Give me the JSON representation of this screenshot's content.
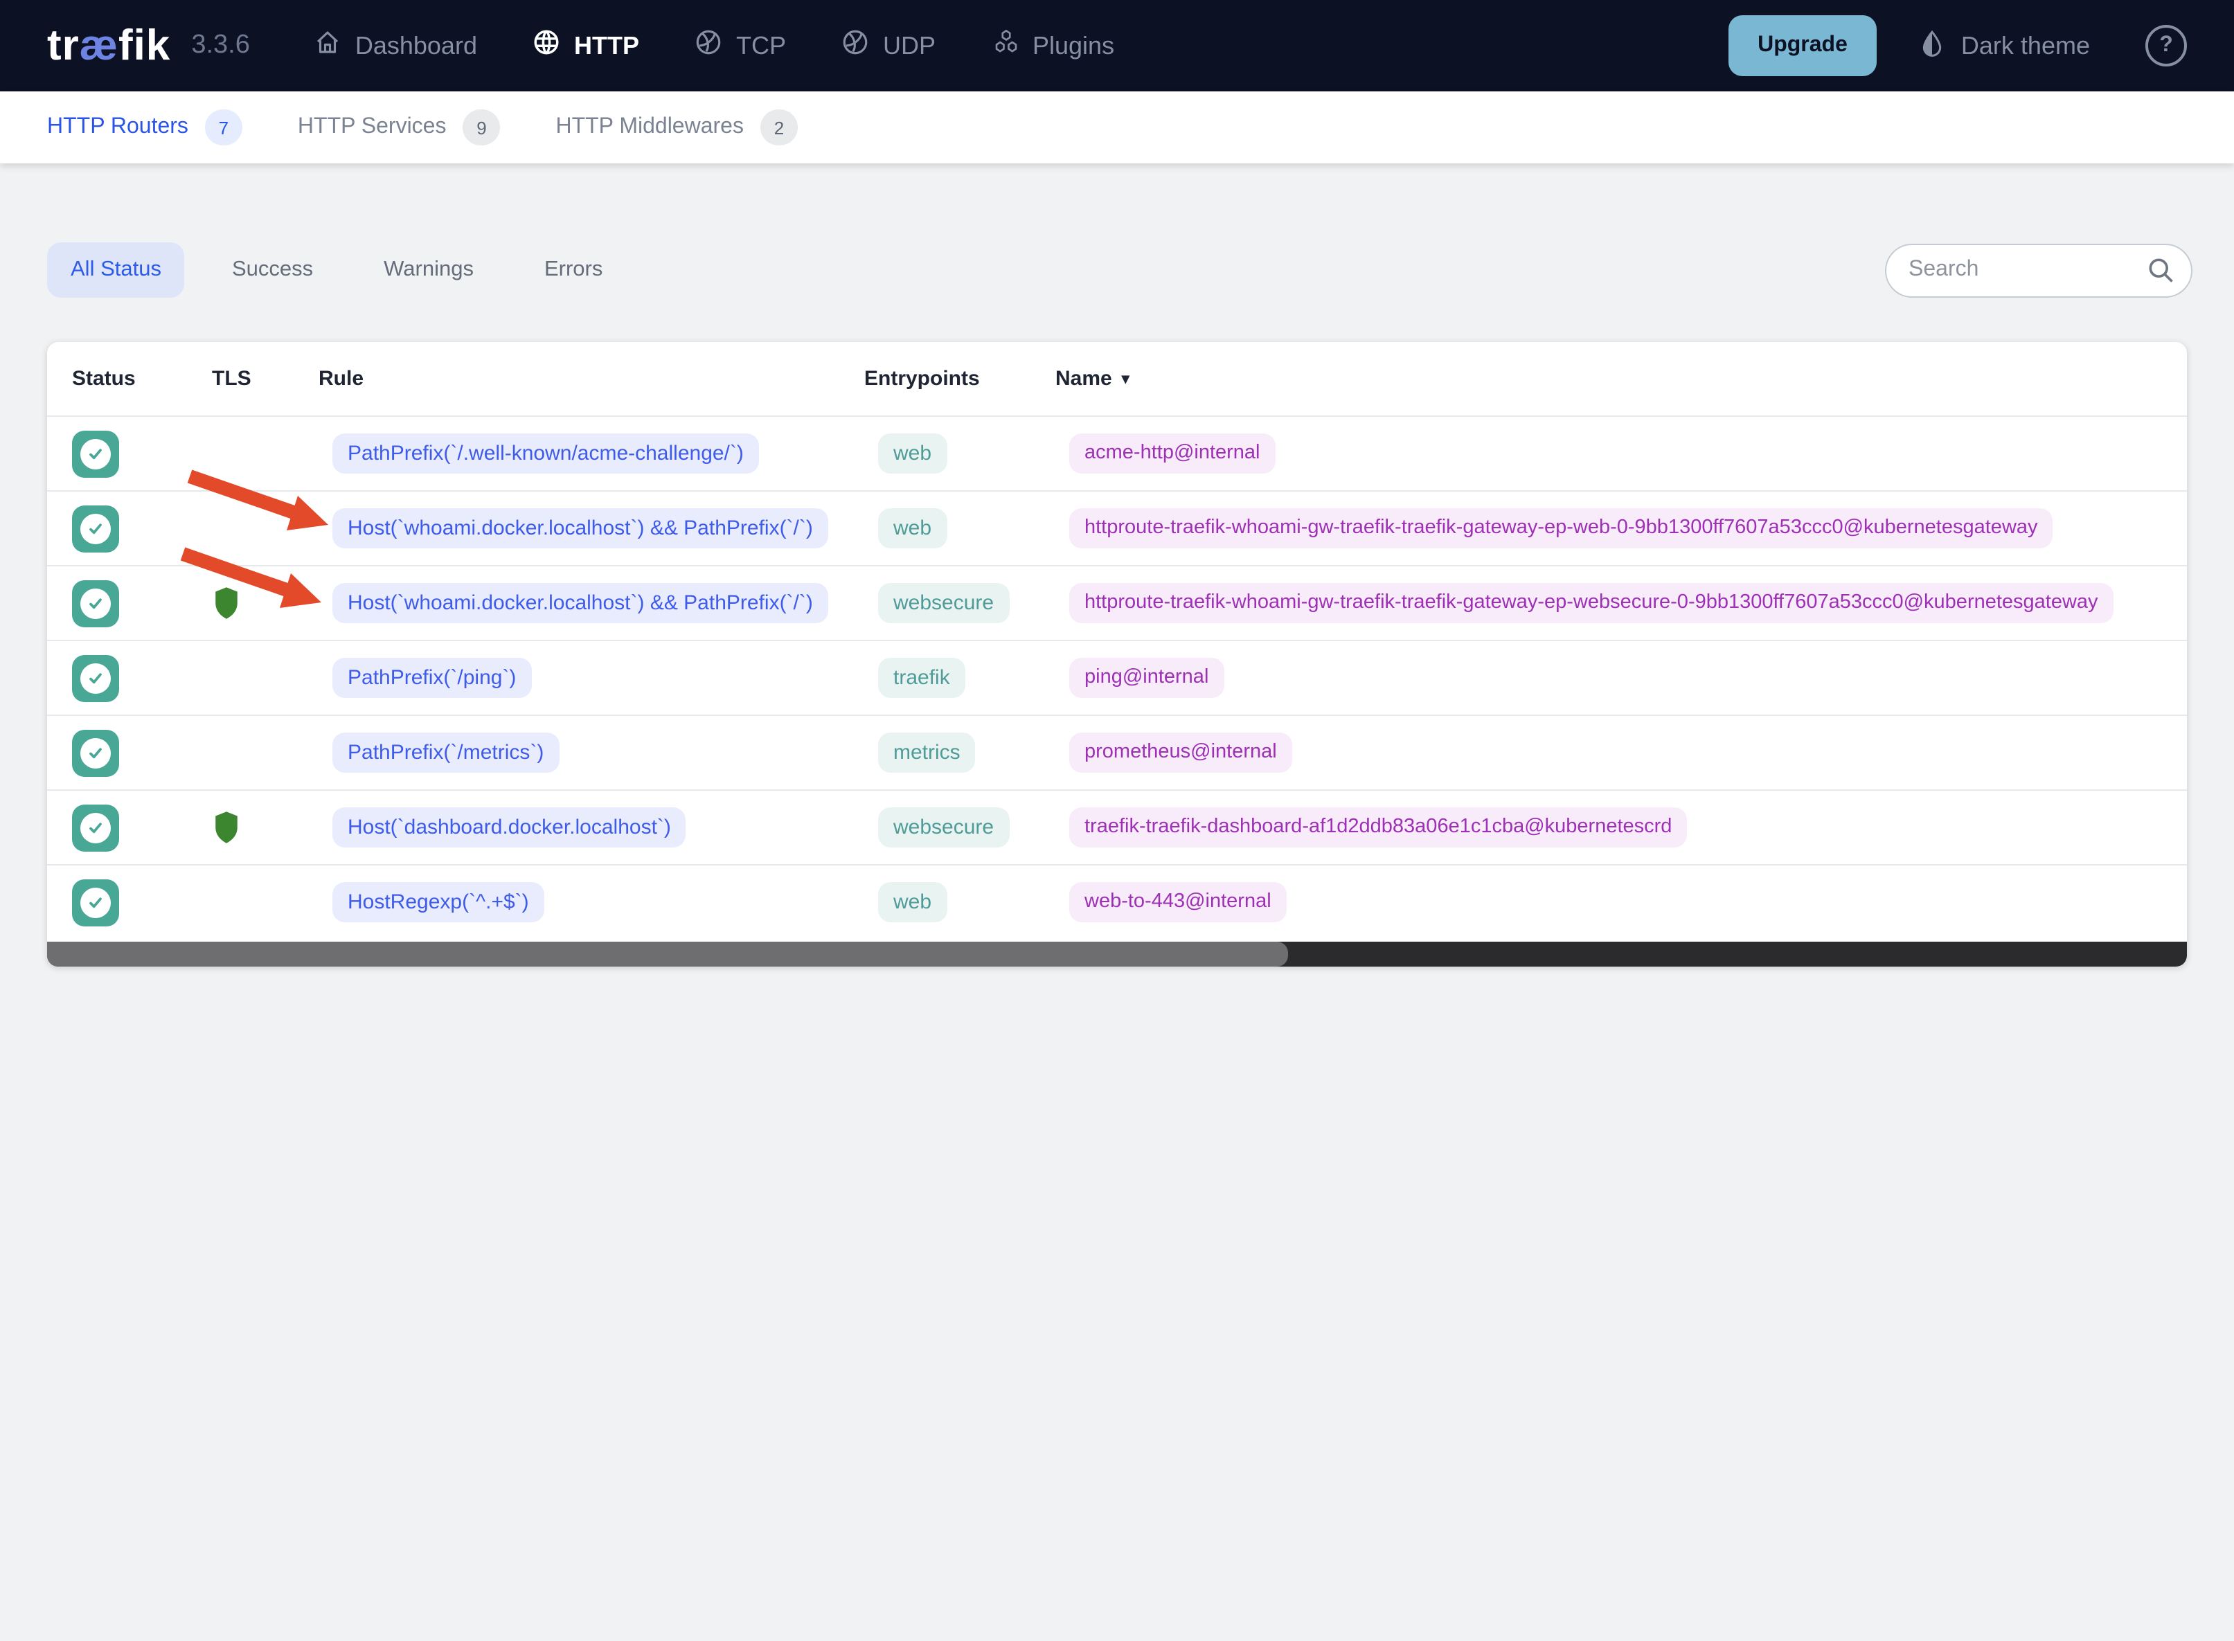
{
  "header": {
    "logo": {
      "pre": "tr",
      "ae": "æ",
      "post": "fik"
    },
    "version": "3.3.6",
    "nav": [
      {
        "label": "Dashboard",
        "icon": "home-icon",
        "active": false
      },
      {
        "label": "HTTP",
        "icon": "globe-icon",
        "active": true
      },
      {
        "label": "TCP",
        "icon": "globe-icon",
        "active": false
      },
      {
        "label": "UDP",
        "icon": "globe-icon",
        "active": false
      },
      {
        "label": "Plugins",
        "icon": "cubes-icon",
        "active": false
      }
    ],
    "upgrade_label": "Upgrade",
    "theme_toggle_label": "Dark theme",
    "help_glyph": "?"
  },
  "subnav": {
    "items": [
      {
        "label": "HTTP Routers",
        "count": "7",
        "active": true
      },
      {
        "label": "HTTP Services",
        "count": "9",
        "active": false
      },
      {
        "label": "HTTP Middlewares",
        "count": "2",
        "active": false
      }
    ]
  },
  "filters": {
    "items": [
      {
        "label": "All Status",
        "active": true
      },
      {
        "label": "Success",
        "active": false
      },
      {
        "label": "Warnings",
        "active": false
      },
      {
        "label": "Errors",
        "active": false
      }
    ]
  },
  "search": {
    "placeholder": "Search"
  },
  "table": {
    "columns": [
      "Status",
      "TLS",
      "Rule",
      "Entrypoints",
      "Name"
    ],
    "sorted_column": "Name",
    "sort_caret": "▾",
    "rows": [
      {
        "status": "ok",
        "tls": false,
        "rule": "PathPrefix(`/.well-known/acme-challenge/`)",
        "entrypoint": "web",
        "name": "acme-http@internal"
      },
      {
        "status": "ok",
        "tls": false,
        "rule": "Host(`whoami.docker.localhost`) && PathPrefix(`/`)",
        "entrypoint": "web",
        "name": "httproute-traefik-whoami-gw-traefik-traefik-gateway-ep-web-0-9bb1300ff7607a53ccc0@kubernetesgateway"
      },
      {
        "status": "ok",
        "tls": true,
        "rule": "Host(`whoami.docker.localhost`) && PathPrefix(`/`)",
        "entrypoint": "websecure",
        "name": "httproute-traefik-whoami-gw-traefik-traefik-gateway-ep-websecure-0-9bb1300ff7607a53ccc0@kubernetesgateway"
      },
      {
        "status": "ok",
        "tls": false,
        "rule": "PathPrefix(`/ping`)",
        "entrypoint": "traefik",
        "name": "ping@internal"
      },
      {
        "status": "ok",
        "tls": false,
        "rule": "PathPrefix(`/metrics`)",
        "entrypoint": "metrics",
        "name": "prometheus@internal"
      },
      {
        "status": "ok",
        "tls": true,
        "rule": "Host(`dashboard.docker.localhost`)",
        "entrypoint": "websecure",
        "name": "traefik-traefik-dashboard-af1d2ddb83a06e1c1cba@kubernetescrd"
      },
      {
        "status": "ok",
        "tls": false,
        "rule": "HostRegexp(`^.+$`)",
        "entrypoint": "web",
        "name": "web-to-443@internal"
      }
    ],
    "scrollbar": {
      "thumb_percent": 58
    }
  },
  "colors": {
    "header_bg": "#0c1123",
    "accent_blue": "#2a53e8",
    "status_teal": "#49a795",
    "name_purple": "#9d30b4",
    "shield_green": "#3d8630",
    "arrow_red": "#e24a29",
    "upgrade_bg": "#7ab7d2"
  }
}
